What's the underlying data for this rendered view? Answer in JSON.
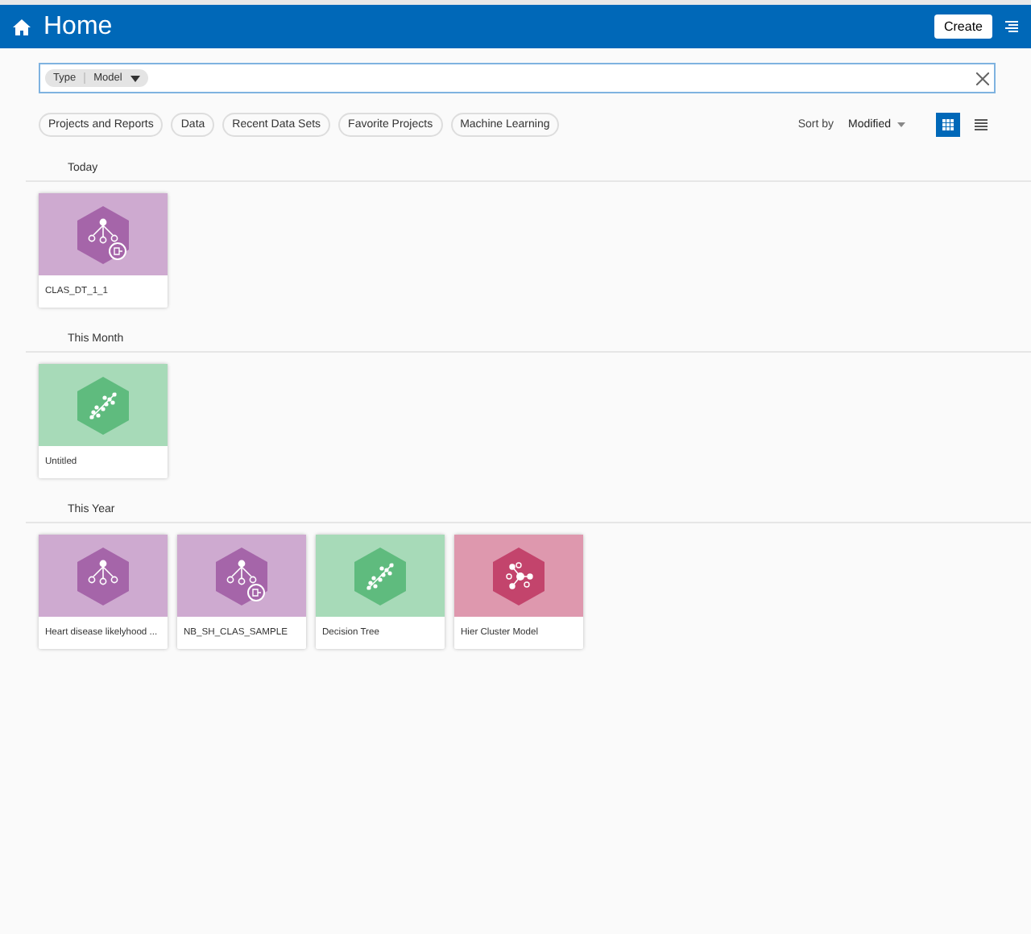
{
  "header": {
    "title": "Home",
    "create_button": "Create"
  },
  "search": {
    "filter": {
      "label": "Type",
      "value": "Model"
    }
  },
  "chips": [
    "Projects and Reports",
    "Data",
    "Recent Data Sets",
    "Favorite Projects",
    "Machine Learning"
  ],
  "sort": {
    "label": "Sort by",
    "value": "Modified"
  },
  "view_toggle": [
    {
      "kind": "grid",
      "selected": true
    },
    {
      "kind": "list",
      "selected": false
    }
  ],
  "sections": [
    {
      "title": "Today",
      "cards": [
        {
          "name": "CLAS_DT_1_1",
          "kind": "tree-badge",
          "color": "#a565a9"
        }
      ]
    },
    {
      "title": "This Month",
      "cards": [
        {
          "name": "Untitled",
          "kind": "scatter",
          "color": "#5fbb7e"
        }
      ]
    },
    {
      "title": "This Year",
      "cards": [
        {
          "name": "Heart disease likelyhood ...",
          "kind": "tree",
          "color": "#a565a9"
        },
        {
          "name": "NB_SH_CLAS_SAMPLE",
          "kind": "tree-badge",
          "color": "#a565a9"
        },
        {
          "name": "Decision Tree",
          "kind": "scatter",
          "color": "#5fbb7e"
        },
        {
          "name": "Hier Cluster Model",
          "kind": "cluster",
          "color": "#c3446c"
        }
      ]
    }
  ]
}
